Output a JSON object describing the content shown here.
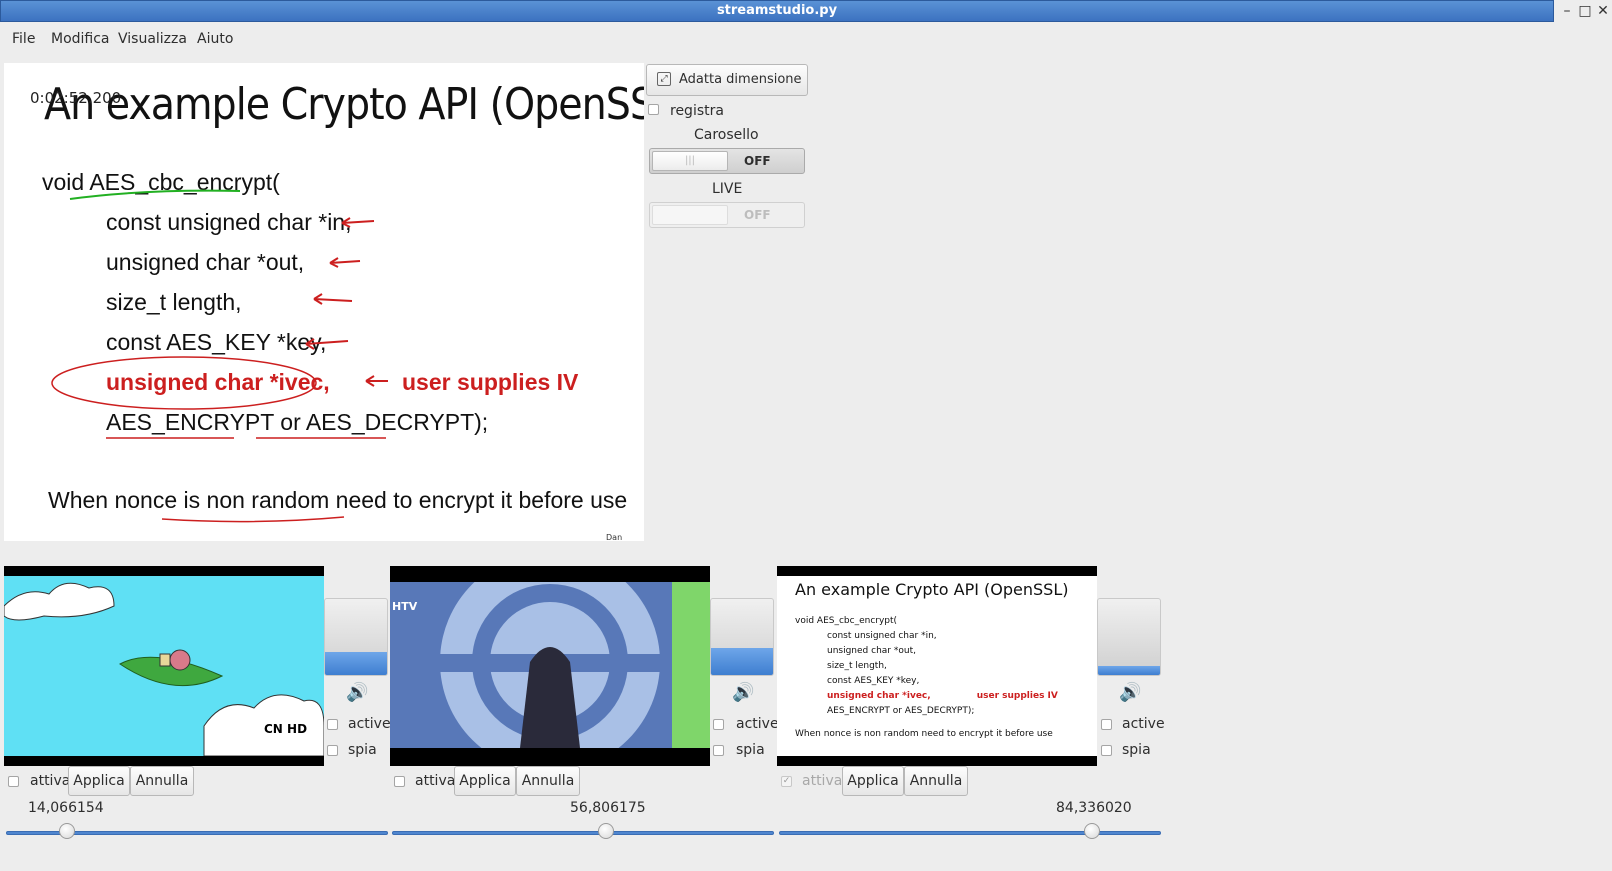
{
  "window": {
    "title": "streamstudio.py"
  },
  "menu": [
    "File",
    "Modifica",
    "Visualizza",
    "Aiuto"
  ],
  "main_view": {
    "timestamp": "0:02:52.200",
    "slide": {
      "title": "An example Crypto API    (OpenSSL)",
      "lines": [
        "void AES_cbc_encrypt(",
        "const unsigned char *in,",
        "unsigned char *out,",
        "size_t length,",
        "const AES_KEY *key,",
        "unsigned char *ivec,",
        "AES_ENCRYPT or AES_DECRYPT);"
      ],
      "annotation": "user supplies IV",
      "footer": "When nonce is non random need to encrypt it before use",
      "credit": "Dan Boneh"
    }
  },
  "controls": {
    "fit_button": "Adatta dimensione",
    "record_label": "registra",
    "carousel_label": "Carosello",
    "carousel_state": "OFF",
    "live_label": "LIVE",
    "live_state": "OFF"
  },
  "sources": [
    {
      "active_label": "active",
      "spy_label": "spia",
      "enable_label": "attiva",
      "apply_label": "Applica",
      "cancel_label": "Annulla",
      "value": "14,066154",
      "slider": 0.16,
      "volume": 0.3,
      "tv_logo": "CN HD",
      "enabled": false
    },
    {
      "active_label": "active",
      "spy_label": "spia",
      "enable_label": "attiva",
      "apply_label": "Applica",
      "cancel_label": "Annulla",
      "value": "56,806175",
      "slider": 0.56,
      "volume": 0.35,
      "tv_logo": "HTV",
      "enabled": false
    },
    {
      "active_label": "active",
      "spy_label": "spia",
      "enable_label": "attiva",
      "apply_label": "Applica",
      "cancel_label": "Annulla",
      "value": "84,336020",
      "slider": 0.82,
      "volume": 0.12,
      "enabled": true
    }
  ],
  "colors": {
    "titlebar": "#3c72c0",
    "accent": "#4f86cf",
    "annotation_red": "#cc1f1f",
    "underline_green": "#22b022"
  }
}
